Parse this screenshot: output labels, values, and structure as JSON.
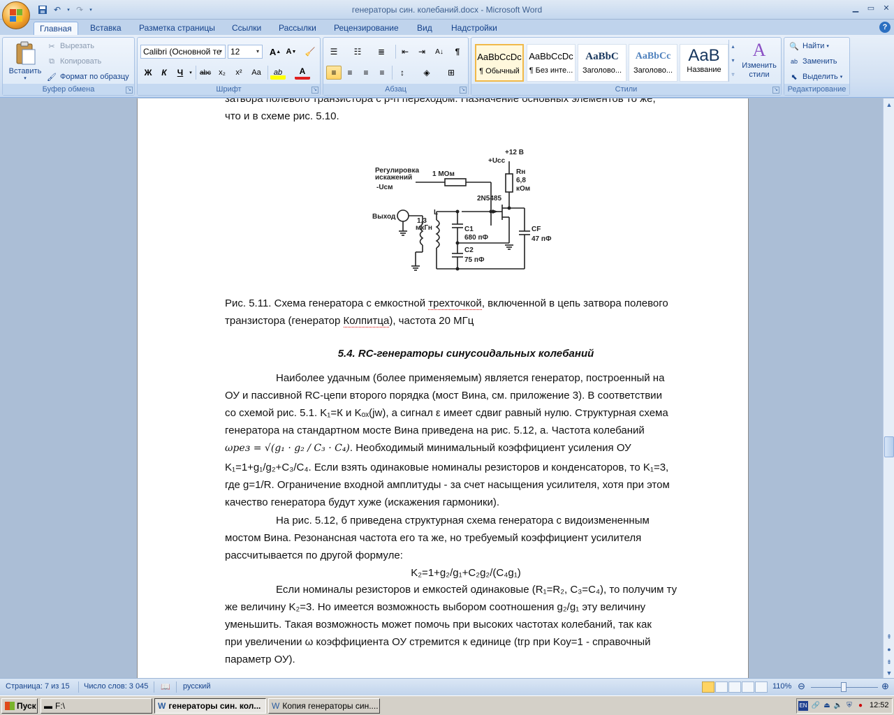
{
  "window": {
    "title": "генераторы син. колебаний.docx - Microsoft Word",
    "controls": [
      "minimize",
      "maximize",
      "close"
    ]
  },
  "quick_access": {
    "icons": [
      "save-icon",
      "undo-icon",
      "redo-icon",
      "customize-icon"
    ]
  },
  "ribbon": {
    "tabs": [
      "Главная",
      "Вставка",
      "Разметка страницы",
      "Ссылки",
      "Рассылки",
      "Рецензирование",
      "Вид",
      "Надстройки"
    ],
    "active_tab": "Главная",
    "clipboard": {
      "paste_label": "Вставить",
      "cut_label": "Вырезать",
      "copy_label": "Копировать",
      "format_painter_label": "Формат по образцу",
      "group_label": "Буфер обмена"
    },
    "font": {
      "family": "Calibri (Основной те",
      "size": "12",
      "group_label": "Шрифт",
      "grow_label": "A",
      "shrink_label": "A",
      "bold": "Ж",
      "italic": "К",
      "underline": "Ч",
      "strike": "abc",
      "subscript": "x₂",
      "superscript": "x²",
      "case": "Aa",
      "highlight": "ab",
      "color": "A"
    },
    "paragraph": {
      "group_label": "Абзац",
      "pilcrow": "¶"
    },
    "styles": {
      "group_label": "Стили",
      "items": [
        {
          "sample": "AaBbCcDc",
          "name": "¶ Обычный",
          "selected": true
        },
        {
          "sample": "AaBbCcDc",
          "name": "¶ Без инте...",
          "selected": false
        },
        {
          "sample": "AaBbC",
          "name": "Заголово...",
          "selected": false
        },
        {
          "sample": "AaBbCc",
          "name": "Заголово...",
          "selected": false
        },
        {
          "sample": "AaB",
          "name": "Название",
          "selected": false
        }
      ],
      "change_styles_label": "Изменить стили"
    },
    "editing": {
      "group_label": "Редактирование",
      "find_label": "Найти",
      "replace_label": "Заменить",
      "select_label": "Выделить"
    }
  },
  "document": {
    "top_cut_line": "затвора полевого транзистора с p-n переходом. Назначение основных элементов то же,",
    "top_line2": "что и в схеме рис. 5.10.",
    "figure": {
      "labels": [
        "Регулировка",
        "искажений",
        "-Uсм",
        "1 МОм",
        "+12 В",
        "+Ucc",
        "Rн",
        "6,8",
        "кОм",
        "2N5485",
        "Выход",
        "L",
        "1,3",
        "мкГн",
        "C1",
        "680 пФ",
        "C2",
        "75 пФ",
        "CF",
        "47 пФ"
      ]
    },
    "caption_line1_pre": "Рис. 5.11. Схема генератора с емкостной ",
    "caption_line1_err": "трехточкой",
    "caption_line1_post": ", включенной в цепь затвора полевого",
    "caption_line2_pre": "транзистора (генератор ",
    "caption_line2_err": "Колпитца",
    "caption_line2_post": "), частота 20 МГц",
    "heading": "5.4. RC-генераторы синусоидальных колебаний",
    "p1_l1": "Наиболее удачным (более применяемым) является генератор, построенный на",
    "p1_l2": "ОУ и пассивной RC-цепи второго порядка (мост Вина, см. приложение 3). В соответствии",
    "p1_l3": "со схемой рис. 5.1. K₁=К и Kₒₓ(jw), а сигнал ε имеет сдвиг равный нулю. Структурная схема",
    "p1_l4": "генератора на стандартном мосте Вина приведена на рис. 5.12, а. Частота колебаний",
    "formula_omega": "ωрез = √(g₁ · g₂ / C₃ · C₄)",
    "p1_l5_post": ". Необходимый минимальный коэффициент усиления ОУ",
    "p1_l6": "K₁=1+g₁/g₂+C₃/C₄. Если взять одинаковые номиналы резисторов и конденсаторов, то K₁=3,",
    "p1_l7": "где g=1/R. Ограничение входной амплитуды - за счет насыщения усилителя, хотя при этом",
    "p1_l8": "качество генератора будут хуже (искажения гармоники).",
    "p2_l1": "На рис. 5.12, б приведена структурная схема генератора с видоизмененным",
    "p2_l2": "мостом Вина. Резонансная частота его та же, но требуемый коэффициент усилителя",
    "p2_l3": "рассчитывается по другой формуле:",
    "formula_k2": "K₂=1+g₂/g₁+C₂g₂/(C₄g₁)",
    "p3_l1": "Если номиналы резисторов и емкостей одинаковые (R₁=R₂, C₃=C₄), то получим ту",
    "p3_l2": "же величину K₂=3. Но имеется возможность выбором соотношения g₂/g₁ эту величину",
    "p3_l3": "уменьшить. Такая возможность может помочь при высоких частотах колебаний, так как",
    "p3_l4": "при увеличении ω коэффициента ОУ стремится к единице (tгр при Kоу=1 - справочный",
    "p3_l5": "параметр ОУ)."
  },
  "statusbar": {
    "page": "Страница: 7 из 15",
    "words": "Число слов: 3 045",
    "language": "русский",
    "zoom": "110%"
  },
  "taskbar": {
    "start_label": "Пуск",
    "tasks": [
      {
        "label": "F:\\",
        "active": false
      },
      {
        "label": "генераторы син. кол...",
        "active": true
      },
      {
        "label": "Копия генераторы син....",
        "active": false
      }
    ],
    "lang": "EN",
    "clock": "12:52"
  }
}
